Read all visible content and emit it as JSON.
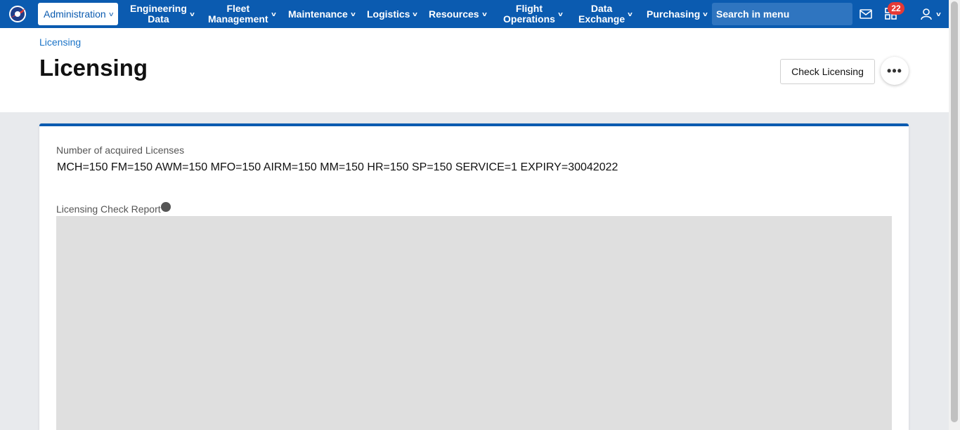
{
  "nav": {
    "items": [
      {
        "label": "Administration",
        "active": true
      },
      {
        "label": "Engineering\nData"
      },
      {
        "label": "Fleet\nManagement"
      },
      {
        "label": "Maintenance"
      },
      {
        "label": "Logistics"
      },
      {
        "label": "Resources"
      },
      {
        "label": "Flight\nOperations"
      },
      {
        "label": "Data\nExchange"
      },
      {
        "label": "Purchasing"
      }
    ],
    "search_placeholder": "Search in menu",
    "notification_count": "22",
    "icons": [
      "mail-icon",
      "apps-icon",
      "user-icon"
    ]
  },
  "header": {
    "breadcrumb": "Licensing",
    "title": "Licensing",
    "check_button": "Check Licensing",
    "more_button": "•••"
  },
  "card": {
    "licenses_label": "Number of acquired Licenses",
    "licenses_value": "MCH=150 FM=150 AWM=150 MFO=150 AIRM=150 MM=150 HR=150 SP=150 SERVICE=1 EXPIRY=30042022",
    "report_label": "Licensing Check Report"
  },
  "colors": {
    "brand": "#0b5bb0",
    "badge": "#e53935"
  }
}
